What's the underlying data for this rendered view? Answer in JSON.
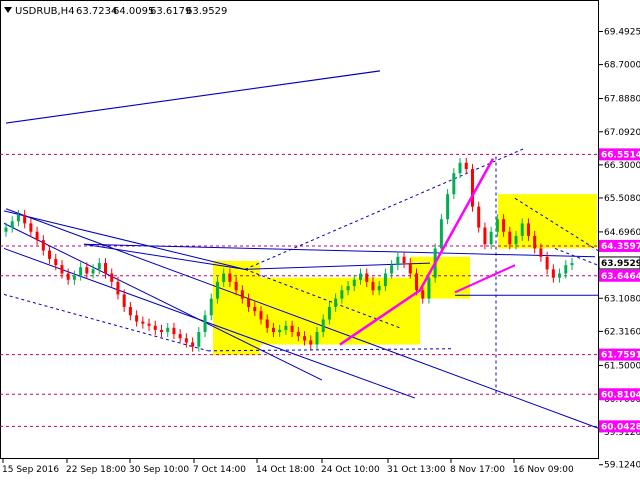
{
  "header": {
    "symbol": "USDRUB,H4",
    "open": "63.7234",
    "high": "64.0095",
    "low": "63.6179",
    "close": "63.9529"
  },
  "colors": {
    "background": "#ffffff",
    "up_candle": "#00b050",
    "down_candle": "#ff0000",
    "channel": "#0000c0",
    "wave": "#ff00ff",
    "hline": "#c00070",
    "zone": "#ffff00",
    "badge_level": "#ff00ff",
    "badge_price": "#ffffff",
    "badge_mid": "#c0c0c0"
  },
  "chart_data": {
    "type": "candlestick",
    "symbol": "USDRUB",
    "timeframe": "H4",
    "ylim": [
      58.95,
      70.15
    ],
    "y_ticks": [
      "69.4925",
      "68.7000",
      "67.8880",
      "67.0920",
      "66.3000",
      "65.5080",
      "64.6960",
      "63.9040",
      "63.1080",
      "62.3160",
      "61.5000",
      "60.7000",
      "59.9120",
      "59.1240"
    ],
    "x_ticks": [
      "15 Sep 2016",
      "22 Sep 18:00",
      "30 Sep 10:00",
      "7 Oct 14:00",
      "14 Oct 18:00",
      "24 Oct 10:00",
      "31 Oct 13:00",
      "8 Nov 17:00",
      "16 Nov 09:00"
    ],
    "level_labels": [
      {
        "label": "66.5514",
        "value": 66.5514,
        "kind": "level"
      },
      {
        "label": "64.3597",
        "value": 64.3597,
        "kind": "level"
      },
      {
        "label": "63.9529",
        "value": 63.9529,
        "kind": "price"
      },
      {
        "label": "63.6464",
        "value": 63.6464,
        "kind": "level"
      },
      {
        "label": "61.7591",
        "value": 61.7591,
        "kind": "level"
      },
      {
        "label": "60.8104",
        "value": 60.8104,
        "kind": "level"
      },
      {
        "label": "60.0428",
        "value": 60.0428,
        "kind": "level"
      }
    ],
    "close_series": [
      64.8,
      64.95,
      65.1,
      64.9,
      64.7,
      64.5,
      64.25,
      64.05,
      63.9,
      63.7,
      63.55,
      63.65,
      63.85,
      63.7,
      63.8,
      63.95,
      63.7,
      63.5,
      63.2,
      62.9,
      62.7,
      62.55,
      62.5,
      62.45,
      62.35,
      62.3,
      62.4,
      62.25,
      62.15,
      62.05,
      61.95,
      62.3,
      62.7,
      63.1,
      63.5,
      63.7,
      63.5,
      63.3,
      63.1,
      62.9,
      62.8,
      62.6,
      62.4,
      62.3,
      62.35,
      62.45,
      62.3,
      62.2,
      62.1,
      62.0,
      62.3,
      62.6,
      62.9,
      63.1,
      63.3,
      63.4,
      63.55,
      63.7,
      63.5,
      63.3,
      63.4,
      63.7,
      63.9,
      64.1,
      63.95,
      63.7,
      63.3,
      63.1,
      63.6,
      64.3,
      65.0,
      65.6,
      66.1,
      66.35,
      66.2,
      65.3,
      64.8,
      64.4,
      64.7,
      65.0,
      64.7,
      64.4,
      64.6,
      64.9,
      64.6,
      64.3,
      64.1,
      63.8,
      63.6,
      63.7,
      63.9,
      63.9529
    ]
  }
}
